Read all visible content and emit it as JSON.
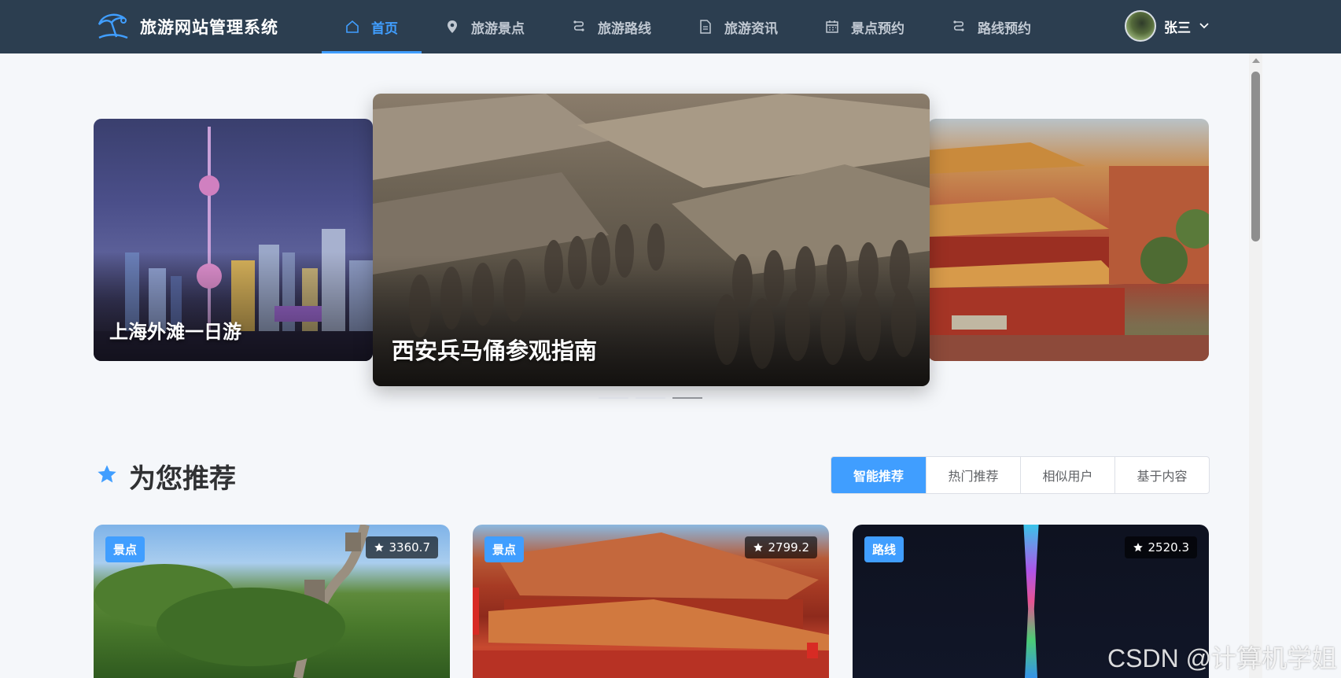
{
  "header": {
    "title": "旅游网站管理系统",
    "nav": [
      {
        "label": "首页",
        "icon": "home-icon",
        "active": true
      },
      {
        "label": "旅游景点",
        "icon": "location-pin-icon"
      },
      {
        "label": "旅游路线",
        "icon": "route-icon"
      },
      {
        "label": "旅游资讯",
        "icon": "document-icon"
      },
      {
        "label": "景点预约",
        "icon": "calendar-icon"
      },
      {
        "label": "路线预约",
        "icon": "route-booking-icon"
      }
    ],
    "user": {
      "name": "张三"
    }
  },
  "carousel": {
    "slides": [
      {
        "title": "上海外滩一日游"
      },
      {
        "title": "西安兵马俑参观指南"
      },
      {
        "title": ""
      }
    ],
    "active_index": 2
  },
  "recommend": {
    "title": "为您推荐",
    "tabs": [
      "智能推荐",
      "热门推荐",
      "相似用户",
      "基于内容"
    ],
    "active_tab": 0,
    "cards": [
      {
        "type": "景点",
        "score": "3360.7"
      },
      {
        "type": "景点",
        "score": "2799.2"
      },
      {
        "type": "路线",
        "score": "2520.3"
      }
    ]
  },
  "watermark": "CSDN @计算机学姐",
  "colors": {
    "header_bg": "#2c3e50",
    "accent": "#409eff",
    "page_bg": "#f5f7fa"
  }
}
